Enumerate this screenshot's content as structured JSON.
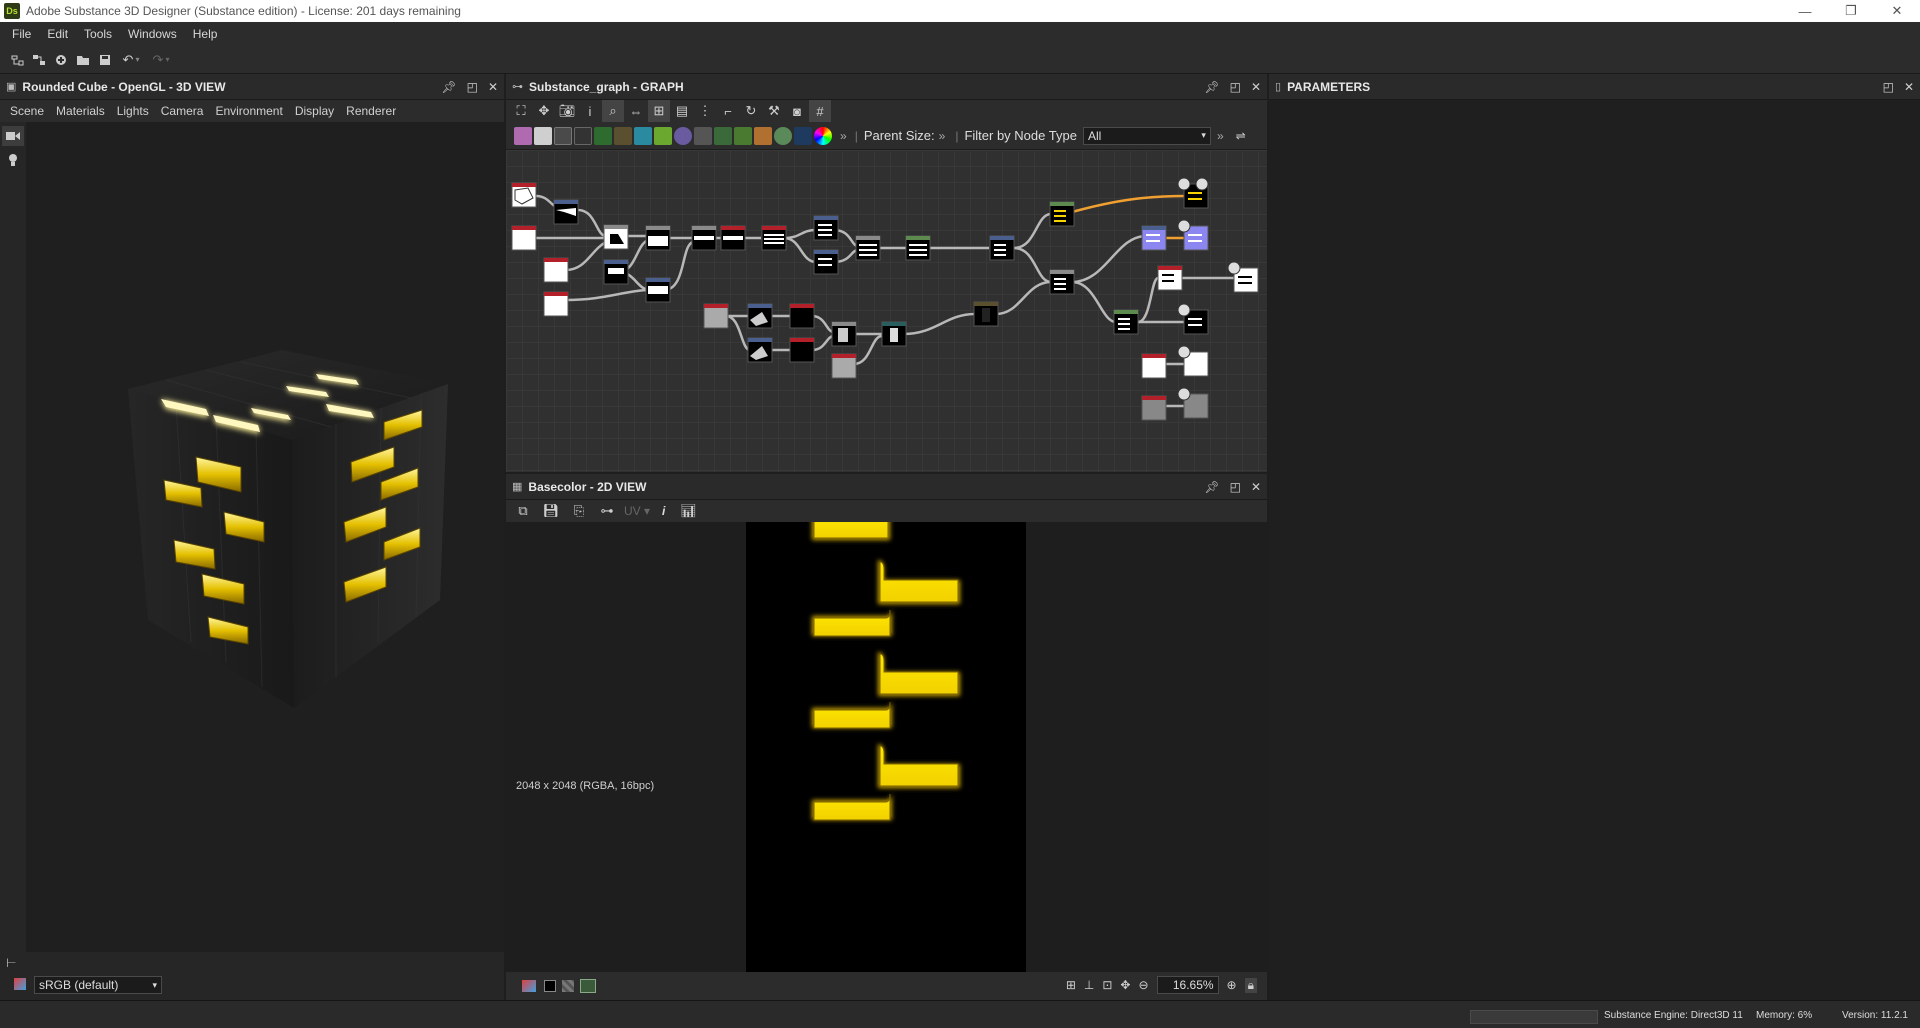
{
  "window": {
    "logo_text": "Ds",
    "title": "Adobe Substance 3D Designer (Substance edition) - License: 201 days remaining",
    "minimize": "—",
    "maximize": "❐",
    "close": "✕"
  },
  "menu": [
    "File",
    "Edit",
    "Tools",
    "Windows",
    "Help"
  ],
  "toolbar": {
    "icons": [
      "new-graph-icon",
      "new-substance-icon",
      "new-package-icon",
      "open-icon",
      "save-all-icon",
      "undo-icon",
      "redo-icon"
    ]
  },
  "panel3d": {
    "title": "Rounded Cube - OpenGL - 3D VIEW",
    "tabs": [
      "Scene",
      "Materials",
      "Lights",
      "Camera",
      "Environment",
      "Display",
      "Renderer"
    ],
    "colorspace": "sRGB (default)"
  },
  "graph": {
    "title": "Substance_graph - GRAPH",
    "parent_size_label": "Parent Size:",
    "filter_label": "Filter by Node Type",
    "filter_value": "All",
    "more": "»"
  },
  "panel2d": {
    "title": "Basecolor - 2D VIEW",
    "uv_label": "UV",
    "info_label": "i",
    "image_info": "2048 x 2048 (RGBA, 16bpc)",
    "zoom": "16.65%"
  },
  "params": {
    "title": "PARAMETERS"
  },
  "status": {
    "engine": "Substance Engine: Direct3D 11",
    "memory": "Memory: 6%",
    "version": "Version: 11.2.1"
  },
  "colors": {
    "accent_yellow": "#f5d400",
    "node_red": "#b3202a",
    "node_blue": "#4a5f8e",
    "node_gray": "#8a8a8a",
    "node_green": "#5d8a4f",
    "wire": "#b8b8b8",
    "wire_orange": "#f0a030",
    "node_purple": "#8b86f0"
  }
}
